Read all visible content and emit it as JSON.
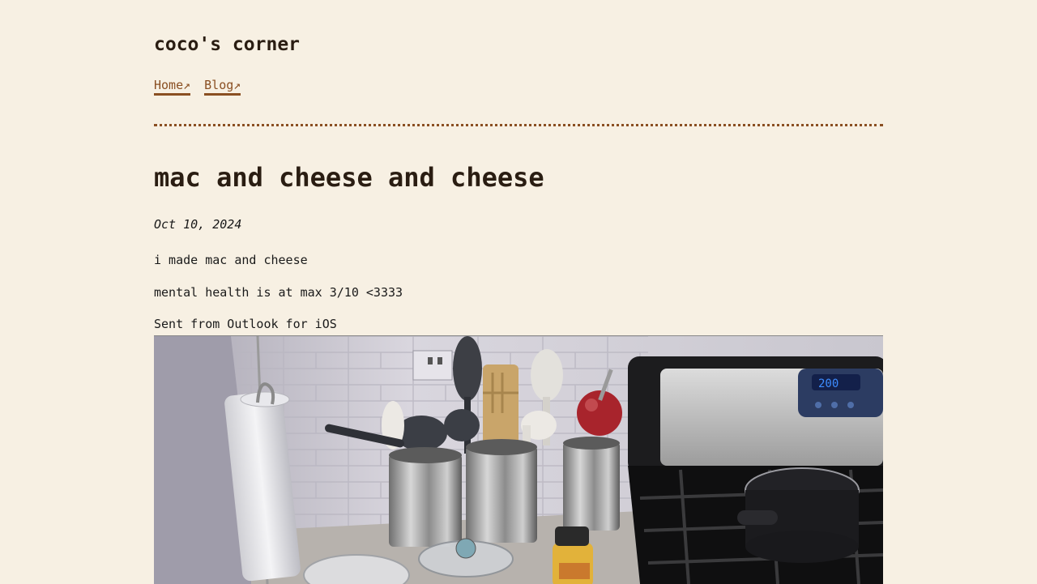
{
  "site": {
    "title": "coco's corner"
  },
  "nav": {
    "items": [
      {
        "label": "Home↗"
      },
      {
        "label": "Blog↗"
      }
    ]
  },
  "post": {
    "title": "mac and cheese and cheese",
    "date": "Oct 10, 2024",
    "paragraphs": [
      "i made mac and cheese",
      "mental health is at max 3/10 <3333",
      "Sent from Outlook for iOS"
    ],
    "photo": {
      "oven_display": "200"
    }
  },
  "colors": {
    "background": "#f7f0e3",
    "accent": "#8a4f22",
    "heading": "#2a1d12"
  }
}
